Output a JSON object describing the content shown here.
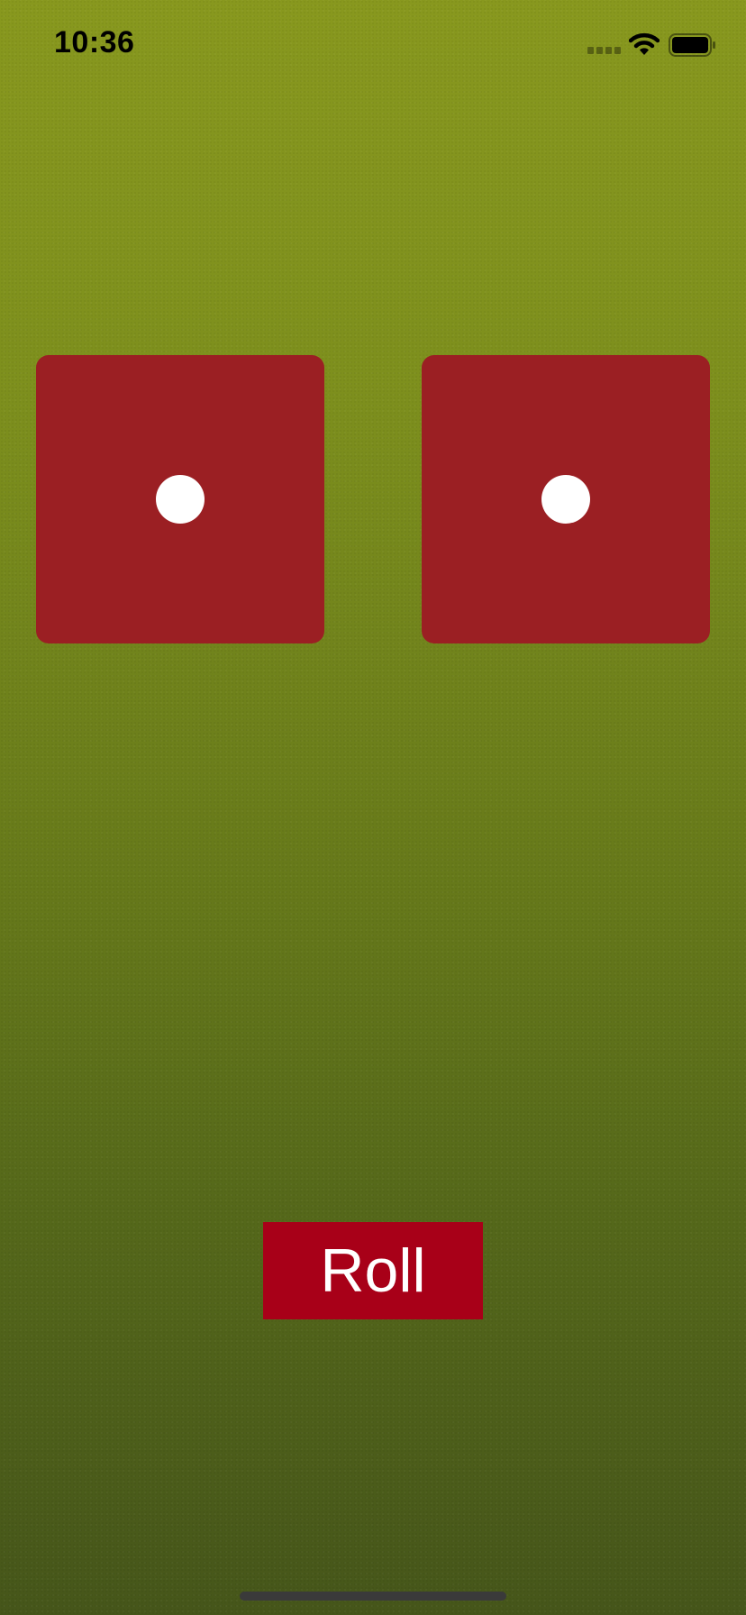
{
  "status_bar": {
    "time": "10:36",
    "icons": [
      "signal-icon",
      "wifi-icon",
      "battery-icon"
    ]
  },
  "dice": [
    {
      "value": 1,
      "color": "#9b1f23",
      "pip_color": "#ffffff"
    },
    {
      "value": 1,
      "color": "#9b1f23",
      "pip_color": "#ffffff"
    }
  ],
  "roll_button": {
    "label": "Roll",
    "color": "#a80018"
  },
  "colors": {
    "felt": "#7d8f1d"
  }
}
